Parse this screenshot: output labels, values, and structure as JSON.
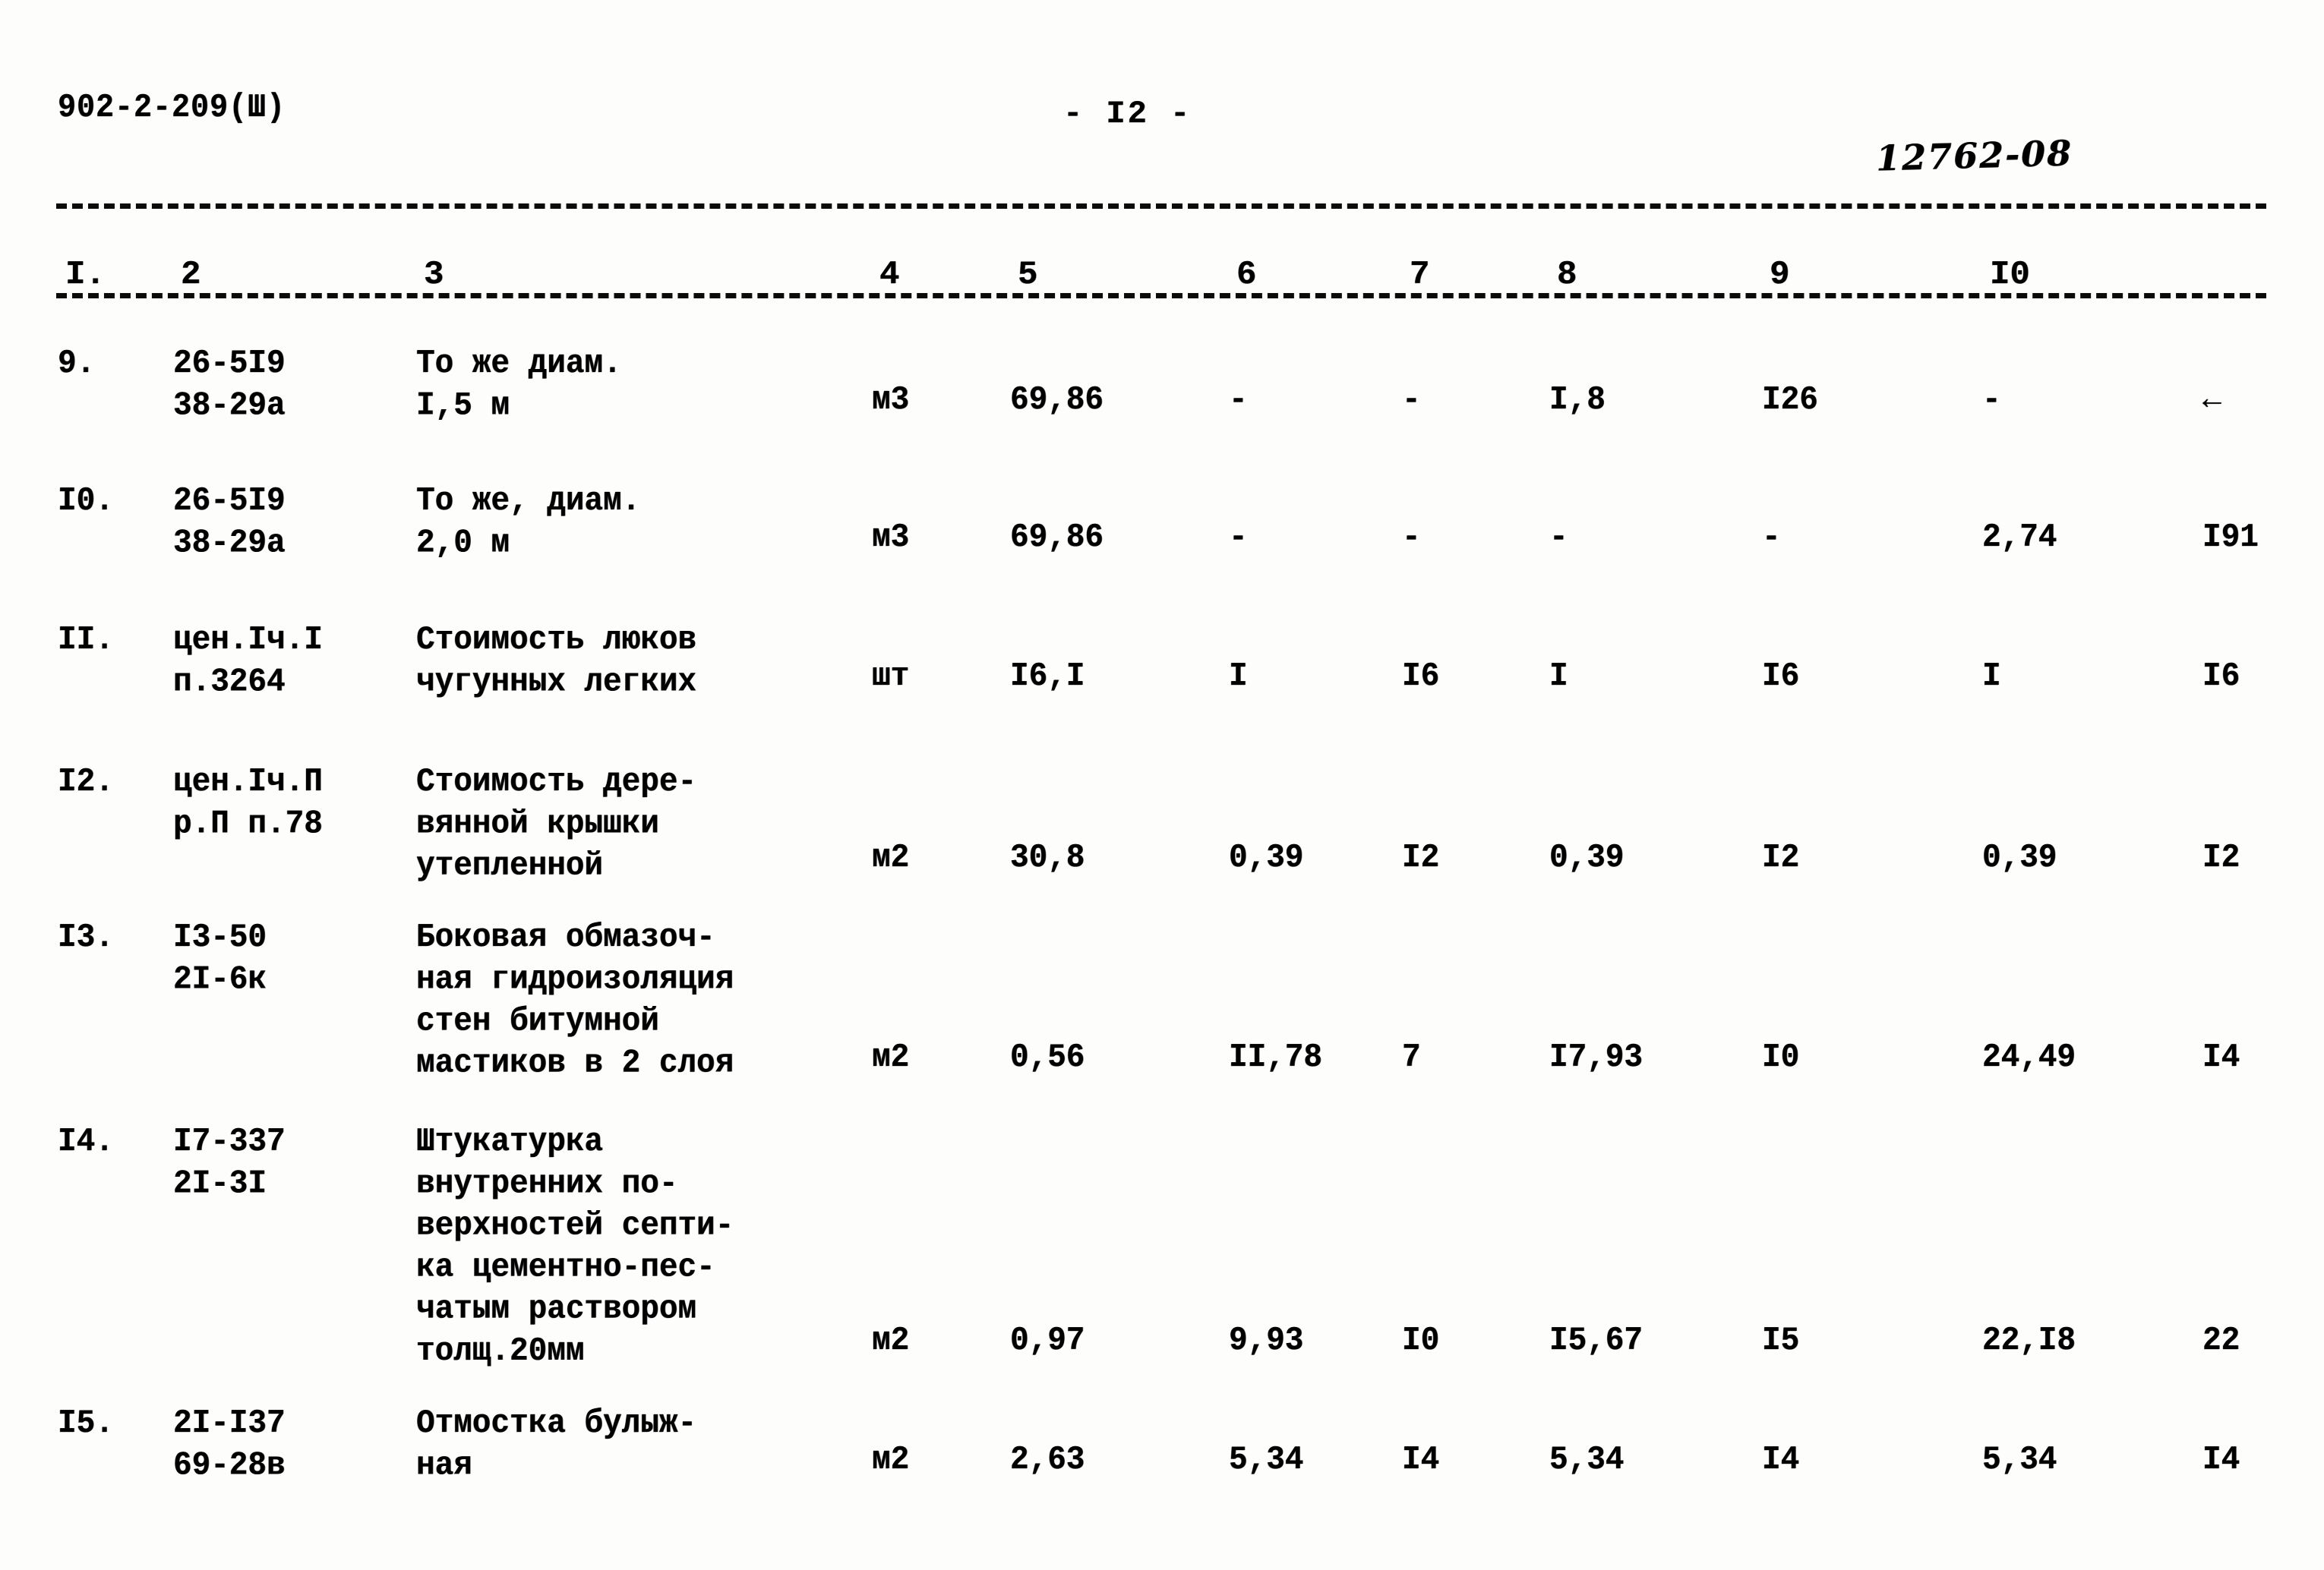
{
  "header": {
    "doc_code": "902-2-209(Ш)",
    "page_label": "- I2 -",
    "stamp": "12762-08"
  },
  "table": {
    "column_headers": [
      "I.",
      "2",
      "3",
      "4",
      "5",
      "6",
      "7",
      "8",
      "9",
      "I0"
    ],
    "rows": [
      {
        "num": "9.",
        "code": "26-5I9\n38-29а",
        "desc": "То же  диам.\nI,5 м",
        "unit": "м3",
        "v1": "69,86",
        "v2": "-",
        "v3": "-",
        "v4": "I,8",
        "v5": "I26",
        "v6": "-",
        "v7": "←"
      },
      {
        "num": "I0.",
        "code": "26-5I9\n38-29а",
        "desc": "То же, диам.\n2,0 м",
        "unit": "м3",
        "v1": "69,86",
        "v2": "-",
        "v3": "-",
        "v4": "-",
        "v5": "-",
        "v6": "2,74",
        "v7": "I91"
      },
      {
        "num": "II.",
        "code": "цен.Iч.I\nп.3264",
        "desc": "Стоимость люков\nчугунных легких",
        "unit": "шт",
        "v1": "I6,I",
        "v2": "I",
        "v3": "I6",
        "v4": "I",
        "v5": "I6",
        "v6": "I",
        "v7": "I6"
      },
      {
        "num": "I2.",
        "code": "цен.Iч.П\nр.П п.78",
        "desc": "Стоимость дере-\nвянной крышки\nутепленной",
        "unit": "м2",
        "v1": "30,8",
        "v2": "0,39",
        "v3": "I2",
        "v4": "0,39",
        "v5": "I2",
        "v6": "0,39",
        "v7": "I2"
      },
      {
        "num": "I3.",
        "code": "I3-50\n2I-6к",
        "desc": "Боковая обмазоч-\nная гидроизоляция\nстен битумной\nмастиков в 2 слоя",
        "unit": "м2",
        "v1": "0,56",
        "v2": "II,78",
        "v3": "7",
        "v4": "I7,93",
        "v5": "I0",
        "v6": "24,49",
        "v7": "I4"
      },
      {
        "num": "I4.",
        "code": "I7-337\n2I-3I",
        "desc": "Штукатурка\nвнутренних по-\nверхностей септи-\nка цементно-пес-\nчатым раствором\nтолщ.20мм",
        "unit": "м2",
        "v1": "0,97",
        "v2": "9,93",
        "v3": "I0",
        "v4": "I5,67",
        "v5": "I5",
        "v6": "22,I8",
        "v7": "22"
      },
      {
        "num": "I5.",
        "code": "2I-I37\n69-28в",
        "desc": "Отмостка булыж-\nная",
        "unit": "м2",
        "v1": "2,63",
        "v2": "5,34",
        "v3": "I4",
        "v4": "5,34",
        "v5": "I4",
        "v6": "5,34",
        "v7": "I4"
      }
    ]
  }
}
